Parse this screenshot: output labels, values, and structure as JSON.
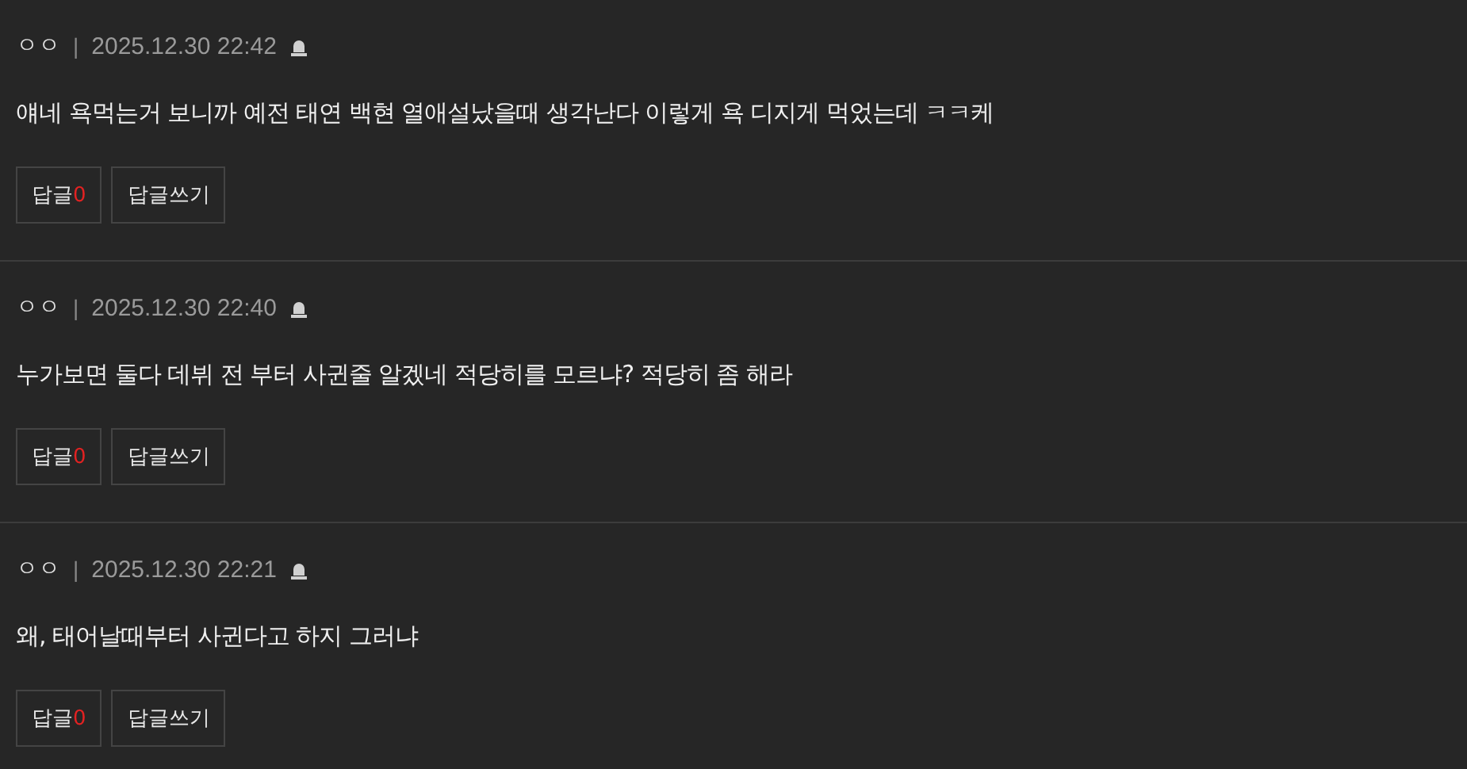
{
  "comments": [
    {
      "author": "ㅇㅇ",
      "separator": "|",
      "time": "2025.12.30 22:42",
      "text": "얘네 욕먹는거 보니까 예전 태연 백현 열애설났을때 생각난다 이렇게 욕 디지게 먹었는데 ㅋㅋ케",
      "reply_label": "답글",
      "reply_count": "0",
      "write_label": "답글쓰기"
    },
    {
      "author": "ㅇㅇ",
      "separator": "|",
      "time": "2025.12.30 22:40",
      "text": "누가보면 둘다 데뷔 전 부터 사귄줄 알겠네 적당히를 모르냐? 적당히 좀 해라",
      "reply_label": "답글",
      "reply_count": "0",
      "write_label": "답글쓰기"
    },
    {
      "author": "ㅇㅇ",
      "separator": "|",
      "time": "2025.12.30 22:21",
      "text": "왜, 태어날때부터 사귄다고 하지 그러냐",
      "reply_label": "답글",
      "reply_count": "0",
      "write_label": "답글쓰기"
    }
  ]
}
